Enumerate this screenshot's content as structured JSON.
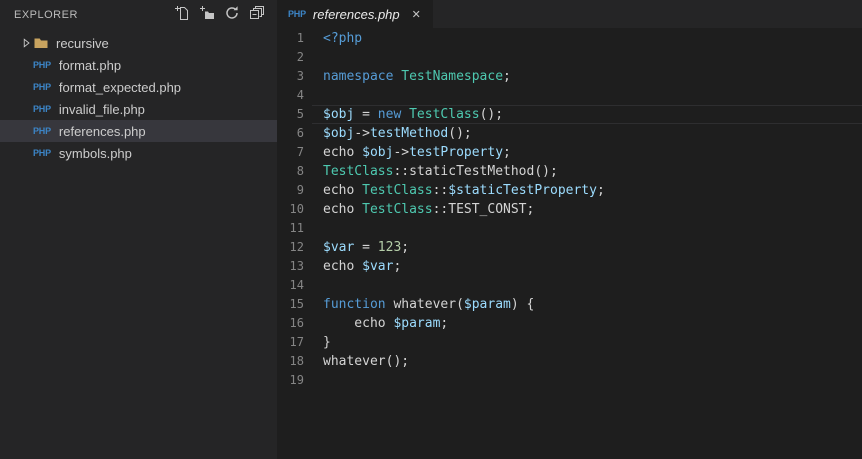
{
  "explorer": {
    "title": "EXPLORER",
    "actions": [
      {
        "name": "new-file",
        "icon": "new-file-icon"
      },
      {
        "name": "new-folder",
        "icon": "new-folder-icon"
      },
      {
        "name": "refresh",
        "icon": "refresh-icon"
      },
      {
        "name": "collapse-all",
        "icon": "collapse-all-icon"
      }
    ],
    "items": [
      {
        "label": "recursive",
        "kind": "folder",
        "expanded": false,
        "selected": false
      },
      {
        "label": "format.php",
        "kind": "php",
        "selected": false
      },
      {
        "label": "format_expected.php",
        "kind": "php",
        "selected": false
      },
      {
        "label": "invalid_file.php",
        "kind": "php",
        "selected": false
      },
      {
        "label": "references.php",
        "kind": "php",
        "selected": true
      },
      {
        "label": "symbols.php",
        "kind": "php",
        "selected": false
      }
    ]
  },
  "icons": {
    "php_badge_text": "PHP"
  },
  "tabbar": {
    "tabs": [
      {
        "label": "references.php",
        "icon": "php",
        "preview": true,
        "active": true,
        "close_label": "✕"
      }
    ]
  },
  "editor": {
    "language": "php",
    "active_line": 5,
    "lines": [
      {
        "num": "1",
        "tokens": [
          [
            "<?php",
            "k"
          ]
        ]
      },
      {
        "num": "2",
        "tokens": []
      },
      {
        "num": "3",
        "tokens": [
          [
            "namespace",
            "k"
          ],
          [
            " ",
            "p"
          ],
          [
            "TestNamespace",
            "cl"
          ],
          [
            ";",
            "p"
          ]
        ]
      },
      {
        "num": "4",
        "tokens": []
      },
      {
        "num": "5",
        "tokens": [
          [
            "$obj",
            "v"
          ],
          [
            " = ",
            "p"
          ],
          [
            "new",
            "k"
          ],
          [
            " ",
            "p"
          ],
          [
            "TestClass",
            "cl"
          ],
          [
            "();",
            "p"
          ]
        ]
      },
      {
        "num": "6",
        "tokens": [
          [
            "$obj",
            "v"
          ],
          [
            "->",
            "p"
          ],
          [
            "testMethod",
            "m"
          ],
          [
            "();",
            "p"
          ]
        ]
      },
      {
        "num": "7",
        "tokens": [
          [
            "echo ",
            "p"
          ],
          [
            "$obj",
            "v"
          ],
          [
            "->",
            "p"
          ],
          [
            "testProperty",
            "m"
          ],
          [
            ";",
            "p"
          ]
        ]
      },
      {
        "num": "8",
        "tokens": [
          [
            "TestClass",
            "cl"
          ],
          [
            "::staticTestMethod();",
            "p"
          ]
        ]
      },
      {
        "num": "9",
        "tokens": [
          [
            "echo ",
            "p"
          ],
          [
            "TestClass",
            "cl"
          ],
          [
            "::",
            "p"
          ],
          [
            "$staticTestProperty",
            "v"
          ],
          [
            ";",
            "p"
          ]
        ]
      },
      {
        "num": "10",
        "tokens": [
          [
            "echo ",
            "p"
          ],
          [
            "TestClass",
            "cl"
          ],
          [
            "::TEST_CONST;",
            "p"
          ]
        ]
      },
      {
        "num": "11",
        "tokens": []
      },
      {
        "num": "12",
        "tokens": [
          [
            "$var",
            "v"
          ],
          [
            " = ",
            "p"
          ],
          [
            "123",
            "n"
          ],
          [
            ";",
            "p"
          ]
        ]
      },
      {
        "num": "13",
        "tokens": [
          [
            "echo ",
            "p"
          ],
          [
            "$var",
            "v"
          ],
          [
            ";",
            "p"
          ]
        ]
      },
      {
        "num": "14",
        "tokens": []
      },
      {
        "num": "15",
        "tokens": [
          [
            "function",
            "k"
          ],
          [
            " whatever(",
            "p"
          ],
          [
            "$param",
            "v"
          ],
          [
            ") {",
            "p"
          ]
        ]
      },
      {
        "num": "16",
        "tokens": [
          [
            "    echo ",
            "p"
          ],
          [
            "$param",
            "v"
          ],
          [
            ";",
            "p"
          ]
        ]
      },
      {
        "num": "17",
        "tokens": [
          [
            "}",
            "p"
          ]
        ]
      },
      {
        "num": "18",
        "tokens": [
          [
            "whatever();",
            "p"
          ]
        ]
      },
      {
        "num": "19",
        "tokens": []
      }
    ]
  },
  "colors": {
    "editor_background": "#1e1e1e",
    "sidebar_background": "#252526",
    "selected_row": "#37373d",
    "keyword": "#569cd6",
    "class": "#4ec9b0",
    "variable": "#9cdcfe",
    "member": "#9cdcfe",
    "number": "#b5cea8",
    "plain": "#d4d4d4",
    "php_icon": "#3c85c7",
    "folder_icon": "#c8a35f",
    "line_number": "#858585"
  }
}
